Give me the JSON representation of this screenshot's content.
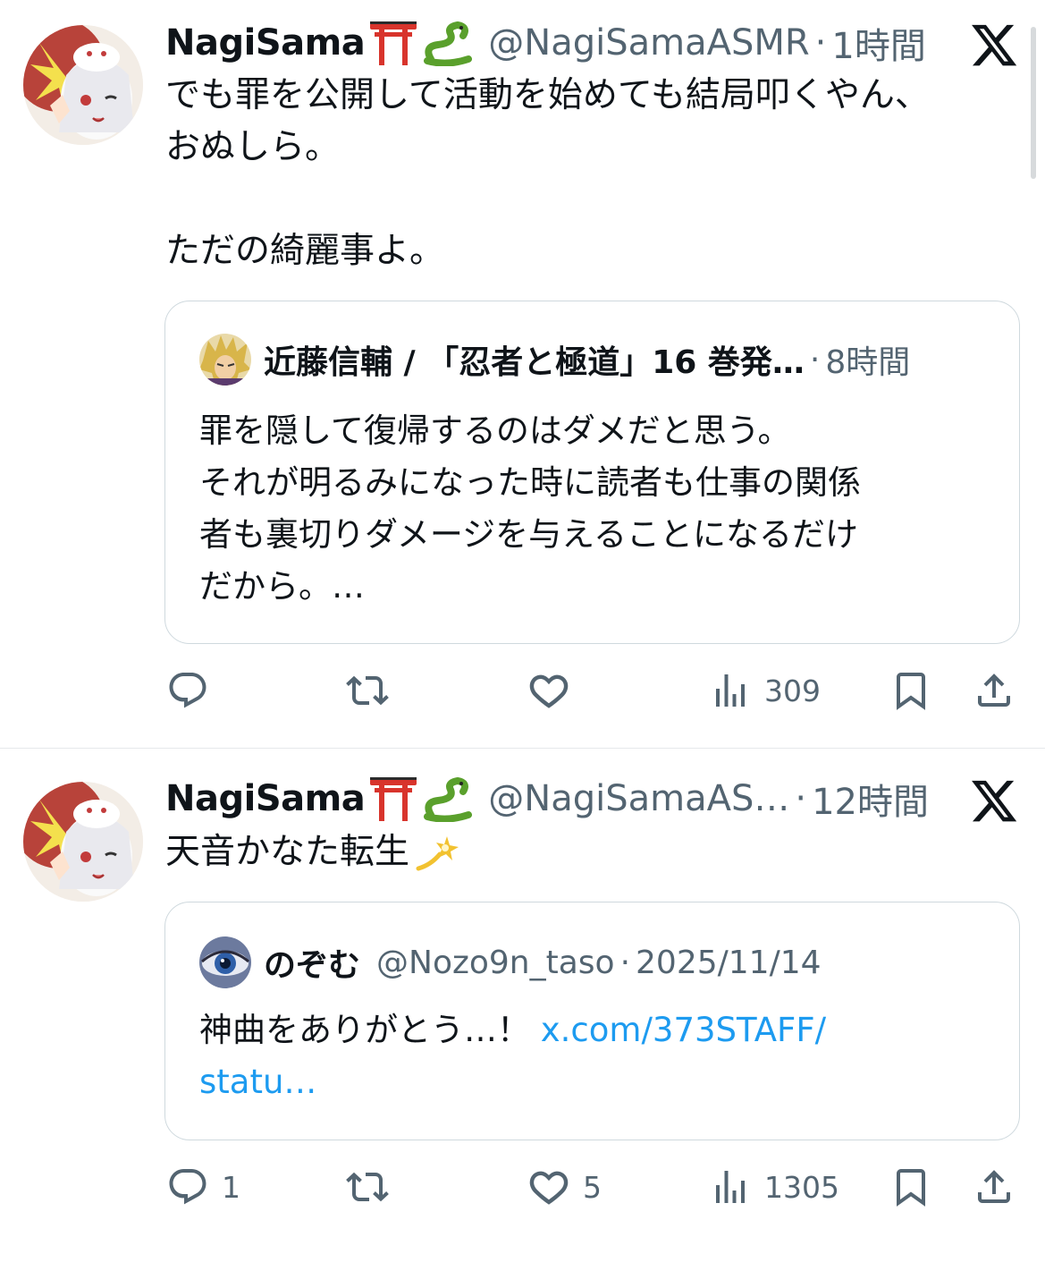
{
  "tweets": [
    {
      "author": {
        "name": "NagiSama",
        "emoji": [
          "torii-gate",
          "snake"
        ],
        "handle": "@NagiSamaASMR"
      },
      "separator": "·",
      "time": "1時間",
      "text": "でも罪を公開して活動を始めても結局叩くやん、\nおぬしら。\n\nただの綺麗事よ。",
      "quote": {
        "author": {
          "name": "近藤信輔 / 「忍者と極道」16 巻発…",
          "handle": ""
        },
        "separator": "·",
        "time": "8時間",
        "text": "罪を隠して復帰するのはダメだと思う。\nそれが明るみになった時に読者も仕事の関係\n者も裏切りダメージを与えることになるだけ\nだから。…",
        "link": ""
      },
      "actions": {
        "reply": "",
        "retweet": "",
        "like": "",
        "views": "309"
      }
    },
    {
      "author": {
        "name": "NagiSama",
        "emoji": [
          "torii-gate",
          "snake"
        ],
        "handle": "@NagiSamaAS…"
      },
      "separator": "·",
      "time": "12時間",
      "text": "天音かなた転生",
      "text_emoji": "dizzy",
      "quote": {
        "author": {
          "name": "のぞむ",
          "handle": "@Nozo9n_taso"
        },
        "separator": "·",
        "time": "2025/11/14",
        "text": "神曲をありがとう…！ ",
        "link": "x.com/373STAFF/\nstatu…"
      },
      "actions": {
        "reply": "1",
        "retweet": "",
        "like": "5",
        "views": "1305"
      }
    }
  ],
  "colors": {
    "text": "#0f1419",
    "secondary": "#536471",
    "link": "#1d9bf0",
    "border": "#cfd9de"
  },
  "icons": [
    "x-logo-icon",
    "reply-icon",
    "retweet-icon",
    "like-icon",
    "views-icon",
    "bookmark-icon",
    "share-icon"
  ]
}
